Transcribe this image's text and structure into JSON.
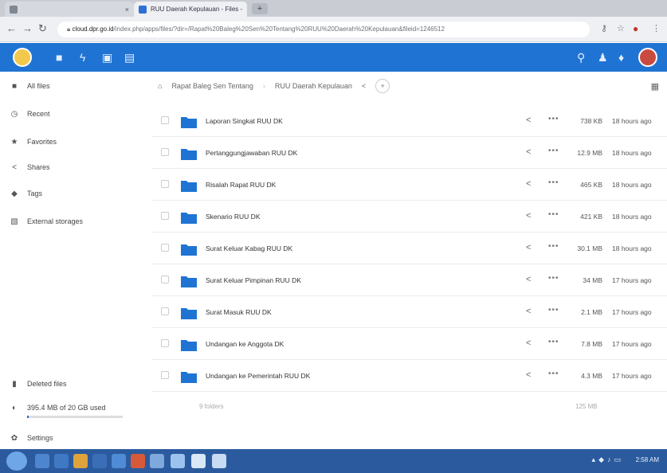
{
  "browser": {
    "tabs": [
      {
        "title": "",
        "active": false
      },
      {
        "title": "RUU Daerah Kepulauan - Files -",
        "active": true
      }
    ],
    "url": {
      "host": "cloud.dpr.go.id",
      "path": "/index.php/apps/files/?dir=/Rapat%20Baleg%20Sen%20Tentang%20RUU%20Daerah%20Kepulauan&fileid=1246512"
    },
    "accent": "#1f74d3"
  },
  "sidebar": {
    "items": [
      {
        "label": "All files",
        "icon": "folder-icon"
      },
      {
        "label": "Recent",
        "icon": "clock-icon"
      },
      {
        "label": "Favorites",
        "icon": "star-icon"
      },
      {
        "label": "Shares",
        "icon": "share-icon"
      },
      {
        "label": "Tags",
        "icon": "tag-icon"
      },
      {
        "label": "External storages",
        "icon": "external-storage-icon"
      }
    ],
    "bottom": {
      "deleted": "Deleted files",
      "quota": "395.4 MB of 20 GB used",
      "quota_fraction": 0.02,
      "settings": "Settings"
    }
  },
  "breadcrumbs": {
    "items": [
      "Rapat Baleg Sen Tentang",
      "RUU Daerah Kepulauan"
    ]
  },
  "files": {
    "rows": [
      {
        "name": "Laporan Singkat RUU DK",
        "size": "738 KB",
        "modified": "18 hours ago"
      },
      {
        "name": "Pertanggungjawaban RUU DK",
        "size": "12.9 MB",
        "modified": "18 hours ago"
      },
      {
        "name": "Risalah Rapat RUU DK",
        "size": "465 KB",
        "modified": "18 hours ago"
      },
      {
        "name": "Skenario RUU DK",
        "size": "421 KB",
        "modified": "18 hours ago"
      },
      {
        "name": "Surat Keluar Kabag RUU DK",
        "size": "30.1 MB",
        "modified": "18 hours ago"
      },
      {
        "name": "Surat Keluar Pimpinan RUU DK",
        "size": "34 MB",
        "modified": "17 hours ago"
      },
      {
        "name": "Surat Masuk RUU DK",
        "size": "2.1 MB",
        "modified": "17 hours ago"
      },
      {
        "name": "Undangan ke Anggota DK",
        "size": "7.8 MB",
        "modified": "17 hours ago"
      },
      {
        "name": "Undangan ke Pemerintah RUU DK",
        "size": "4.3 MB",
        "modified": "17 hours ago"
      }
    ],
    "summary": {
      "count": "9 folders",
      "total": "125 MB"
    }
  },
  "taskbar": {
    "clock": "2:58 AM"
  }
}
